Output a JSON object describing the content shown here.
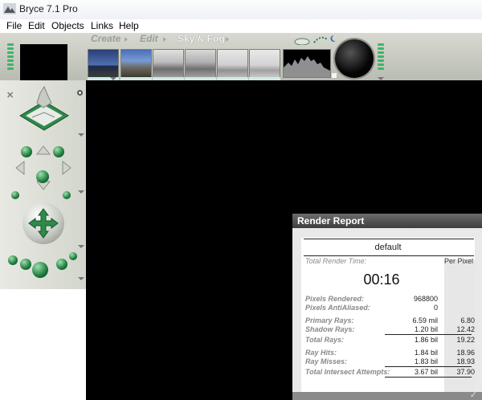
{
  "window": {
    "title": "Bryce 7.1  Pro"
  },
  "menu": {
    "items": [
      "File",
      "Edit",
      "Objects",
      "Links",
      "Help"
    ]
  },
  "tabs": {
    "create": "Create",
    "edit": "Edit",
    "sky_fog": "Sky & Fog",
    "active": "Sky & Fog"
  },
  "report": {
    "title": "Render Report",
    "preset": "default",
    "total_render_time_label": "Total Render Time:",
    "per_pixel_label": "Per Pixel",
    "time": "00:16",
    "pixels_rendered_label": "Pixels Rendered:",
    "pixels_rendered": "968800",
    "pixels_antialiased_label": "Pixels AntiAliased:",
    "pixels_antialiased": "0",
    "primary_rays_label": "Primary Rays:",
    "primary_rays": "6.59 mil",
    "primary_rays_pp": "6.80",
    "shadow_rays_label": "Shadow Rays:",
    "shadow_rays": "1.20 bil",
    "shadow_rays_pp": "12.42",
    "total_rays_label": "Total Rays:",
    "total_rays": "1.86 bil",
    "total_rays_pp": "19.22",
    "ray_hits_label": "Ray Hits:",
    "ray_hits": "1.84 bil",
    "ray_hits_pp": "18.96",
    "ray_misses_label": "Ray Misses:",
    "ray_misses": "1.83 bil",
    "ray_misses_pp": "18.93",
    "total_intersect_label": "Total Intersect Attempts:",
    "total_intersect": "3.67 bil",
    "total_intersect_pp": "37.90"
  },
  "colors": {
    "accent_green": "#2e8b4a",
    "report_header": "#4d4d4d",
    "thumb_bar": "#cfe9e6"
  }
}
